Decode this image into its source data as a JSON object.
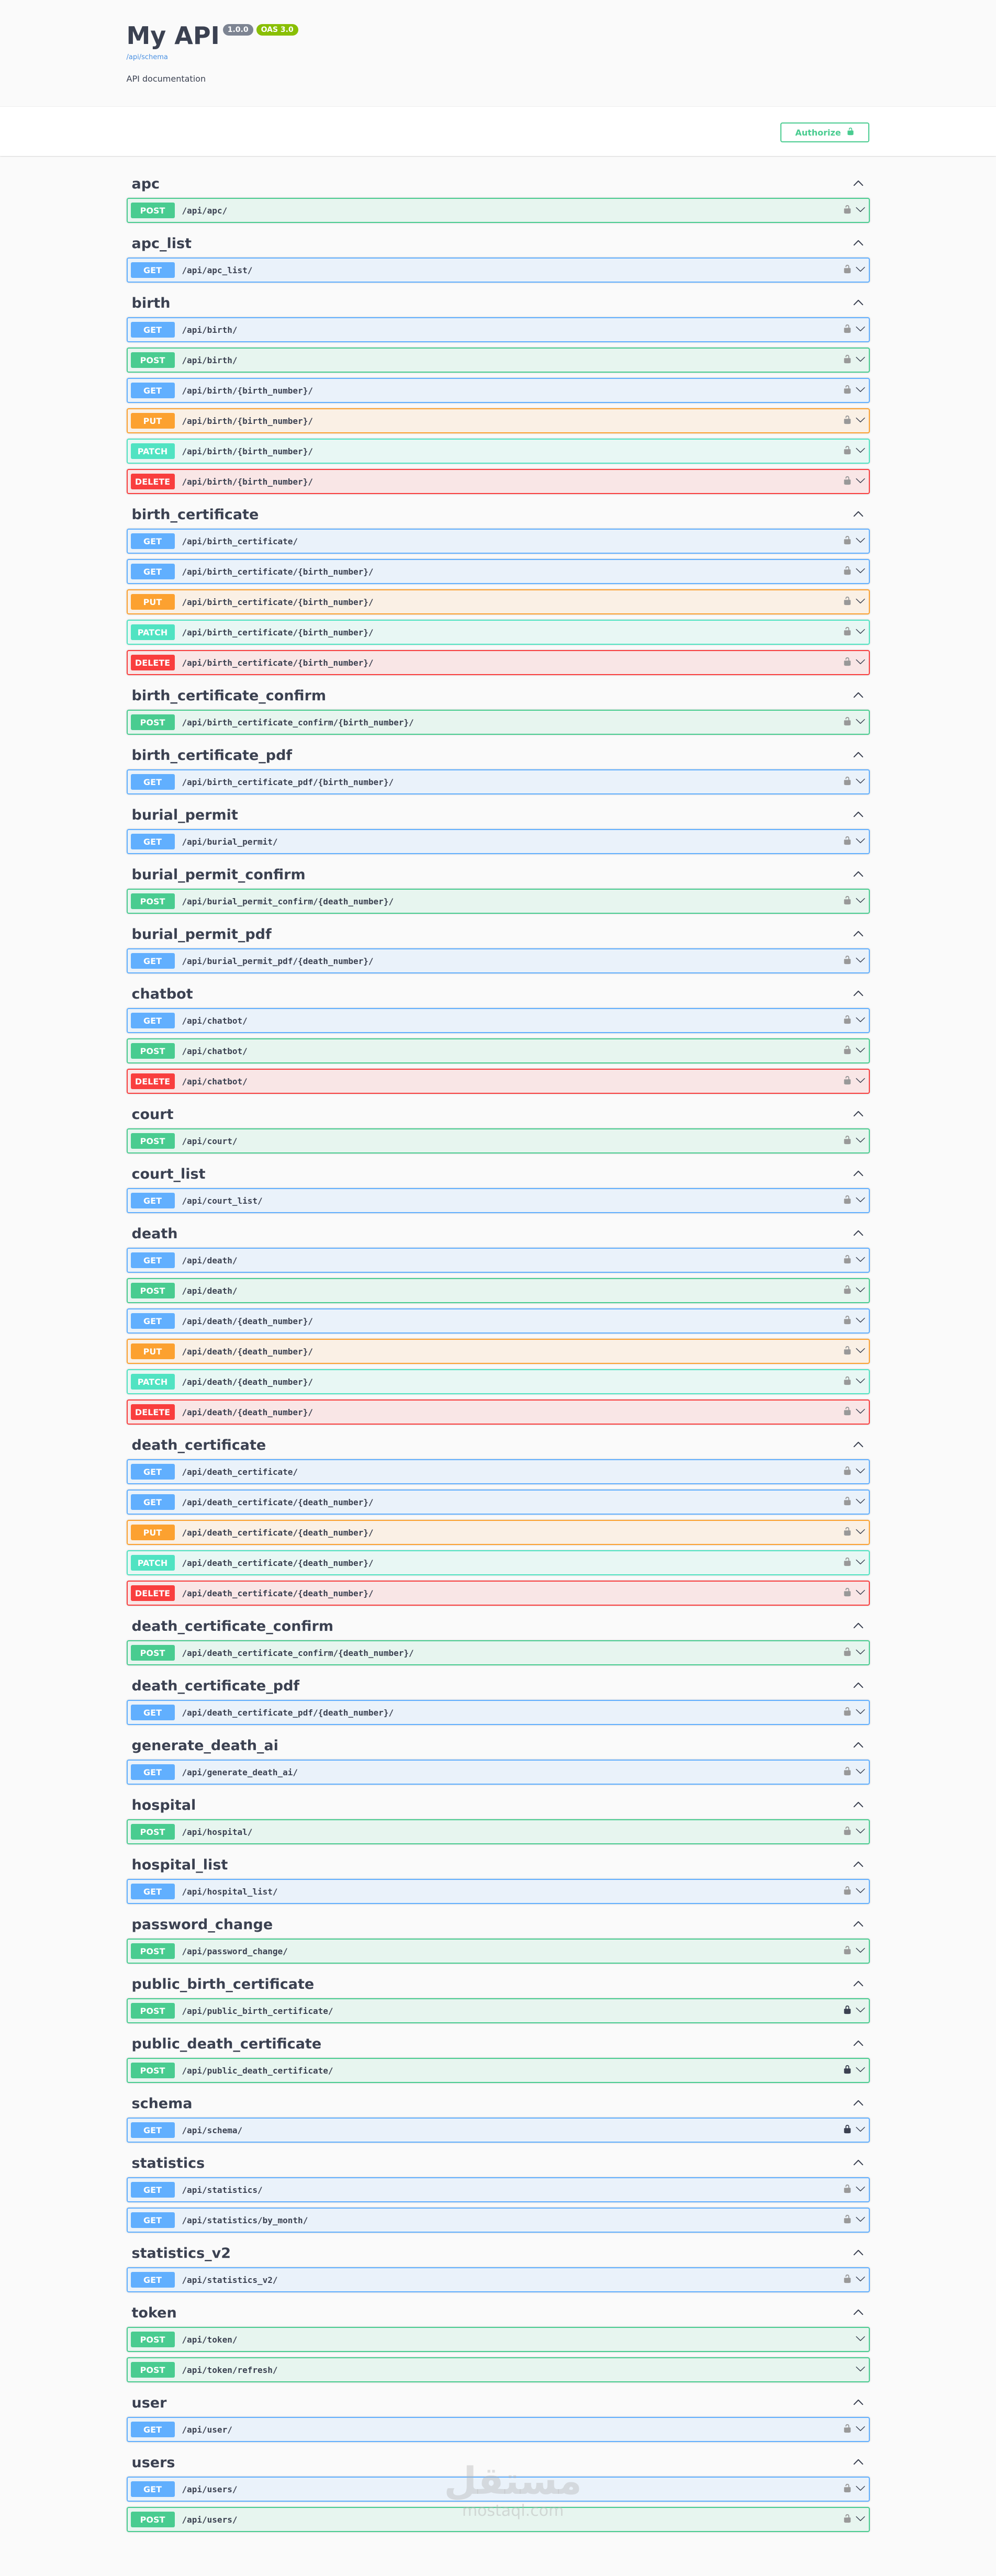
{
  "info": {
    "title": "My API",
    "version": "1.0.0",
    "oas": "OAS 3.0",
    "link": "/api/schema",
    "description": "API documentation"
  },
  "authorize": {
    "label": "Authorize"
  },
  "colors": {
    "get": "#61affe",
    "post": "#49cc90",
    "put": "#fca130",
    "patch": "#50e3c2",
    "delete": "#f93e3e"
  },
  "icons": {
    "lock": "lock-icon",
    "chevron": "chevron-down-icon",
    "collapse": "chevron-up-icon"
  },
  "watermark": {
    "arabic": "مستقل",
    "latin": "mostaql.com"
  },
  "tags": [
    {
      "name": "apc",
      "ops": [
        {
          "method": "POST",
          "path": "/api/apc/",
          "lock": "open"
        }
      ]
    },
    {
      "name": "apc_list",
      "ops": [
        {
          "method": "GET",
          "path": "/api/apc_list/",
          "lock": "open"
        }
      ]
    },
    {
      "name": "birth",
      "ops": [
        {
          "method": "GET",
          "path": "/api/birth/",
          "lock": "open"
        },
        {
          "method": "POST",
          "path": "/api/birth/",
          "lock": "open"
        },
        {
          "method": "GET",
          "path": "/api/birth/{birth_number}/",
          "lock": "open"
        },
        {
          "method": "PUT",
          "path": "/api/birth/{birth_number}/",
          "lock": "open"
        },
        {
          "method": "PATCH",
          "path": "/api/birth/{birth_number}/",
          "lock": "open"
        },
        {
          "method": "DELETE",
          "path": "/api/birth/{birth_number}/",
          "lock": "open"
        }
      ]
    },
    {
      "name": "birth_certificate",
      "ops": [
        {
          "method": "GET",
          "path": "/api/birth_certificate/",
          "lock": "open"
        },
        {
          "method": "GET",
          "path": "/api/birth_certificate/{birth_number}/",
          "lock": "open"
        },
        {
          "method": "PUT",
          "path": "/api/birth_certificate/{birth_number}/",
          "lock": "open"
        },
        {
          "method": "PATCH",
          "path": "/api/birth_certificate/{birth_number}/",
          "lock": "open"
        },
        {
          "method": "DELETE",
          "path": "/api/birth_certificate/{birth_number}/",
          "lock": "open"
        }
      ]
    },
    {
      "name": "birth_certificate_confirm",
      "ops": [
        {
          "method": "POST",
          "path": "/api/birth_certificate_confirm/{birth_number}/",
          "lock": "open"
        }
      ]
    },
    {
      "name": "birth_certificate_pdf",
      "ops": [
        {
          "method": "GET",
          "path": "/api/birth_certificate_pdf/{birth_number}/",
          "lock": "open"
        }
      ]
    },
    {
      "name": "burial_permit",
      "ops": [
        {
          "method": "GET",
          "path": "/api/burial_permit/",
          "lock": "open"
        }
      ]
    },
    {
      "name": "burial_permit_confirm",
      "ops": [
        {
          "method": "POST",
          "path": "/api/burial_permit_confirm/{death_number}/",
          "lock": "open"
        }
      ]
    },
    {
      "name": "burial_permit_pdf",
      "ops": [
        {
          "method": "GET",
          "path": "/api/burial_permit_pdf/{death_number}/",
          "lock": "open"
        }
      ]
    },
    {
      "name": "chatbot",
      "ops": [
        {
          "method": "GET",
          "path": "/api/chatbot/",
          "lock": "open"
        },
        {
          "method": "POST",
          "path": "/api/chatbot/",
          "lock": "open"
        },
        {
          "method": "DELETE",
          "path": "/api/chatbot/",
          "lock": "open"
        }
      ]
    },
    {
      "name": "court",
      "ops": [
        {
          "method": "POST",
          "path": "/api/court/",
          "lock": "open"
        }
      ]
    },
    {
      "name": "court_list",
      "ops": [
        {
          "method": "GET",
          "path": "/api/court_list/",
          "lock": "open"
        }
      ]
    },
    {
      "name": "death",
      "ops": [
        {
          "method": "GET",
          "path": "/api/death/",
          "lock": "open"
        },
        {
          "method": "POST",
          "path": "/api/death/",
          "lock": "open"
        },
        {
          "method": "GET",
          "path": "/api/death/{death_number}/",
          "lock": "open"
        },
        {
          "method": "PUT",
          "path": "/api/death/{death_number}/",
          "lock": "open"
        },
        {
          "method": "PATCH",
          "path": "/api/death/{death_number}/",
          "lock": "open"
        },
        {
          "method": "DELETE",
          "path": "/api/death/{death_number}/",
          "lock": "open"
        }
      ]
    },
    {
      "name": "death_certificate",
      "ops": [
        {
          "method": "GET",
          "path": "/api/death_certificate/",
          "lock": "open"
        },
        {
          "method": "GET",
          "path": "/api/death_certificate/{death_number}/",
          "lock": "open"
        },
        {
          "method": "PUT",
          "path": "/api/death_certificate/{death_number}/",
          "lock": "open"
        },
        {
          "method": "PATCH",
          "path": "/api/death_certificate/{death_number}/",
          "lock": "open"
        },
        {
          "method": "DELETE",
          "path": "/api/death_certificate/{death_number}/",
          "lock": "open"
        }
      ]
    },
    {
      "name": "death_certificate_confirm",
      "ops": [
        {
          "method": "POST",
          "path": "/api/death_certificate_confirm/{death_number}/",
          "lock": "open"
        }
      ]
    },
    {
      "name": "death_certificate_pdf",
      "ops": [
        {
          "method": "GET",
          "path": "/api/death_certificate_pdf/{death_number}/",
          "lock": "open"
        }
      ]
    },
    {
      "name": "generate_death_ai",
      "ops": [
        {
          "method": "GET",
          "path": "/api/generate_death_ai/",
          "lock": "open"
        }
      ]
    },
    {
      "name": "hospital",
      "ops": [
        {
          "method": "POST",
          "path": "/api/hospital/",
          "lock": "open"
        }
      ]
    },
    {
      "name": "hospital_list",
      "ops": [
        {
          "method": "GET",
          "path": "/api/hospital_list/",
          "lock": "open"
        }
      ]
    },
    {
      "name": "password_change",
      "ops": [
        {
          "method": "POST",
          "path": "/api/password_change/",
          "lock": "open"
        }
      ]
    },
    {
      "name": "public_birth_certificate",
      "ops": [
        {
          "method": "POST",
          "path": "/api/public_birth_certificate/",
          "lock": "closed"
        }
      ]
    },
    {
      "name": "public_death_certificate",
      "ops": [
        {
          "method": "POST",
          "path": "/api/public_death_certificate/",
          "lock": "closed"
        }
      ]
    },
    {
      "name": "schema",
      "ops": [
        {
          "method": "GET",
          "path": "/api/schema/",
          "lock": "closed"
        }
      ]
    },
    {
      "name": "statistics",
      "ops": [
        {
          "method": "GET",
          "path": "/api/statistics/",
          "lock": "open"
        },
        {
          "method": "GET",
          "path": "/api/statistics/by_month/",
          "lock": "open"
        }
      ]
    },
    {
      "name": "statistics_v2",
      "ops": [
        {
          "method": "GET",
          "path": "/api/statistics_v2/",
          "lock": "open"
        }
      ]
    },
    {
      "name": "token",
      "ops": [
        {
          "method": "POST",
          "path": "/api/token/",
          "lock": "none"
        },
        {
          "method": "POST",
          "path": "/api/token/refresh/",
          "lock": "none"
        }
      ]
    },
    {
      "name": "user",
      "ops": [
        {
          "method": "GET",
          "path": "/api/user/",
          "lock": "open"
        }
      ]
    },
    {
      "name": "users",
      "ops": [
        {
          "method": "GET",
          "path": "/api/users/",
          "lock": "open"
        },
        {
          "method": "POST",
          "path": "/api/users/",
          "lock": "open"
        }
      ]
    }
  ]
}
